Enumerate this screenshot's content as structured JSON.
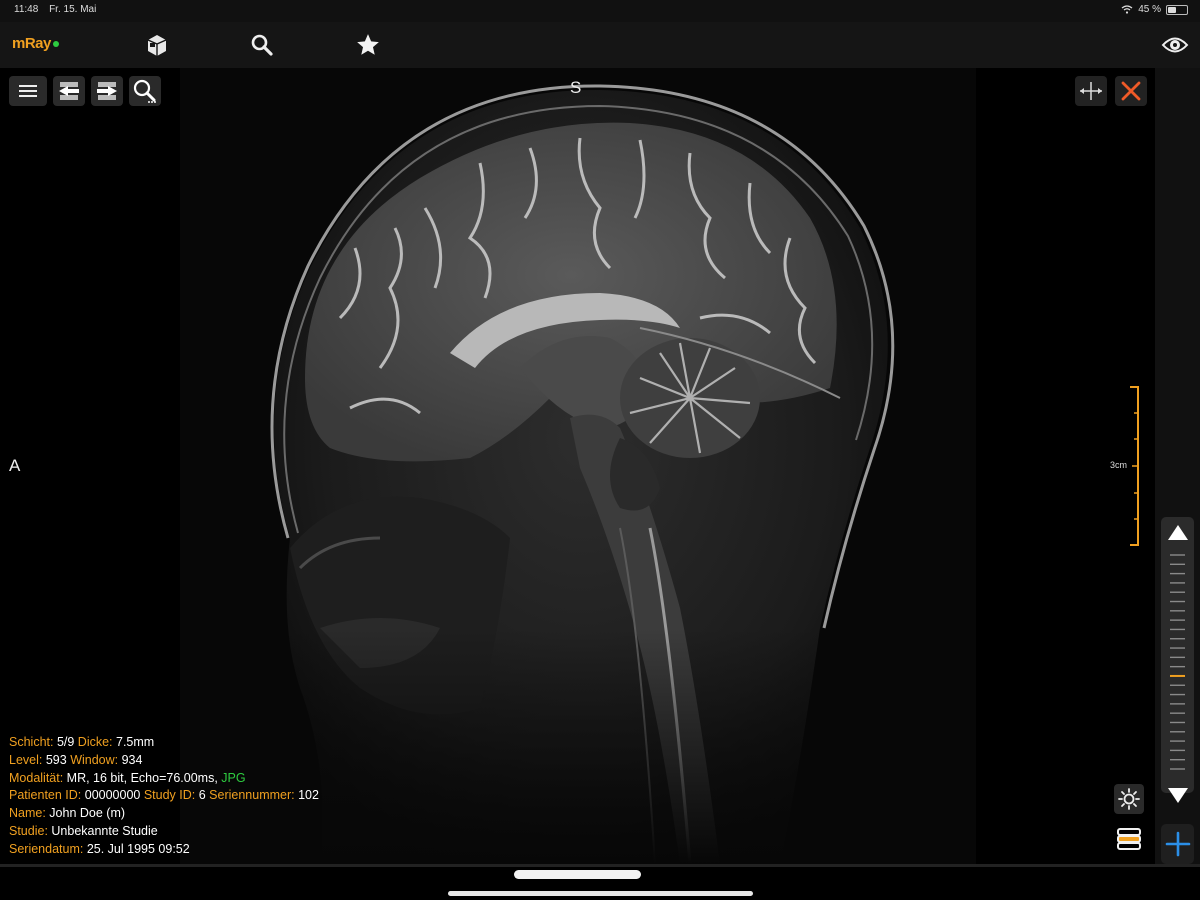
{
  "statusbar": {
    "time": "11:48",
    "date": "Fr. 15. Mai",
    "battery": "45 %",
    "battery_level": 0.45,
    "wifi_icon": "wifi-icon"
  },
  "appbar": {
    "logo": "mRay",
    "logo_status_color": "#2ecc40",
    "icons": [
      "cube-icon",
      "search-icon",
      "star-icon",
      "eye-icon"
    ]
  },
  "viewer": {
    "orientation_top": "S",
    "orientation_left": "A",
    "scale_label": "3cm",
    "accent_color": "#f0a020",
    "left_tools": [
      "menu-icon",
      "series-prev-icon",
      "series-next-icon",
      "zoom-icon"
    ],
    "right_tools": [
      "fit-icon",
      "close-icon"
    ]
  },
  "info": {
    "schicht_label": "Schicht:",
    "schicht_value": "5/9",
    "dicke_label": "Dicke:",
    "dicke_value": "7.5mm",
    "level_label": "Level:",
    "level_value": "593",
    "window_label": "Window:",
    "window_value": "934",
    "modalitaet_label": "Modalität:",
    "modalitaet_value": "MR, 16 bit, Echo=76.00ms,",
    "format_value": "JPG",
    "patient_label": "Patienten ID:",
    "patient_value": "00000000",
    "study_label": "Study ID:",
    "study_value": "6",
    "serie_label": "Seriennummer:",
    "serie_value": "102",
    "name_label": "Name:",
    "name_value": "John Doe (m)",
    "studie_label": "Studie:",
    "studie_value": "Unbekannte Studie",
    "datum_label": "Seriendatum:",
    "datum_value": "25. Jul 1995 09:52"
  },
  "scroller": {
    "current_slice": 5,
    "total_slices": 9
  }
}
